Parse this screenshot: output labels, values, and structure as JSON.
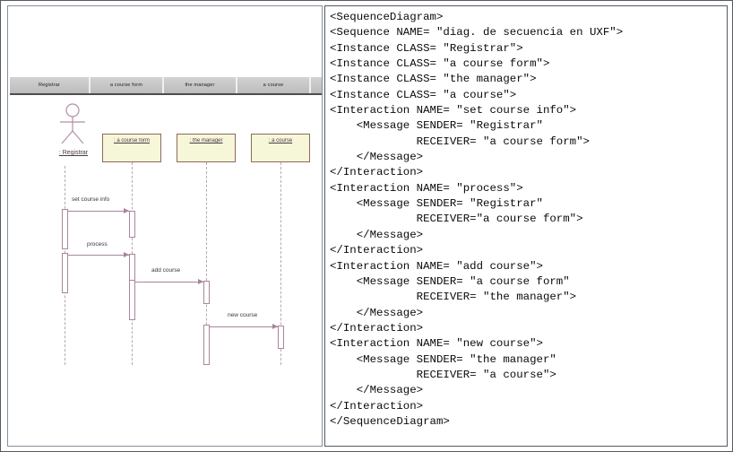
{
  "panels": {
    "diagram": {
      "name": "sequence-diagram-canvas"
    },
    "code": {
      "name": "uxf-xml-source"
    }
  },
  "diagram": {
    "participant_tabs": [
      {
        "label": "Registrar"
      },
      {
        "label": "a course form"
      },
      {
        "label": "the manager"
      },
      {
        "label": "a course"
      }
    ],
    "actor": {
      "label": ": Registrar",
      "icon": "stick-figure-actor-icon"
    },
    "objects": [
      {
        "label": ": a course form"
      },
      {
        "label": ": the manager"
      },
      {
        "label": ": a course"
      }
    ],
    "messages": [
      {
        "label": "set course info",
        "from": "Registrar",
        "to": "a course form"
      },
      {
        "label": "process",
        "from": "Registrar",
        "to": "a course form"
      },
      {
        "label": "add course",
        "from": "a course form",
        "to": "the manager"
      },
      {
        "label": "new course",
        "from": "the manager",
        "to": "a course"
      }
    ],
    "colors": {
      "header_bar": "#c6c6c6",
      "object_fill": "#f6f6d8",
      "object_border": "#8b6a5e",
      "lifeline": "#b9a6b4",
      "message": "#a8859c",
      "text": "#4a3a46"
    }
  },
  "code": {
    "language": "UXF XML",
    "text": "<SequenceDiagram>\n<Sequence NAME= \"diag. de secuencia en UXF\">\n<Instance CLASS= \"Registrar\">\n<Instance CLASS= \"a course form\">\n<Instance CLASS= \"the manager\">\n<Instance CLASS= \"a course\">\n<Interaction NAME= \"set course info\">\n    <Message SENDER= \"Registrar\"\n             RECEIVER= \"a course form\">\n    </Message>\n</Interaction>\n<Interaction NAME= \"process\">\n    <Message SENDER= \"Registrar\"\n             RECEIVER=\"a course form\">\n    </Message>\n</Interaction>\n<Interaction NAME= \"add course\">\n    <Message SENDER= \"a course form\"\n             RECEIVER= \"the manager\">\n    </Message>\n</Interaction>\n<Interaction NAME= \"new course\">\n    <Message SENDER= \"the manager\"\n             RECEIVER= \"a course\">\n    </Message>\n</Interaction>\n</SequenceDiagram>"
  }
}
